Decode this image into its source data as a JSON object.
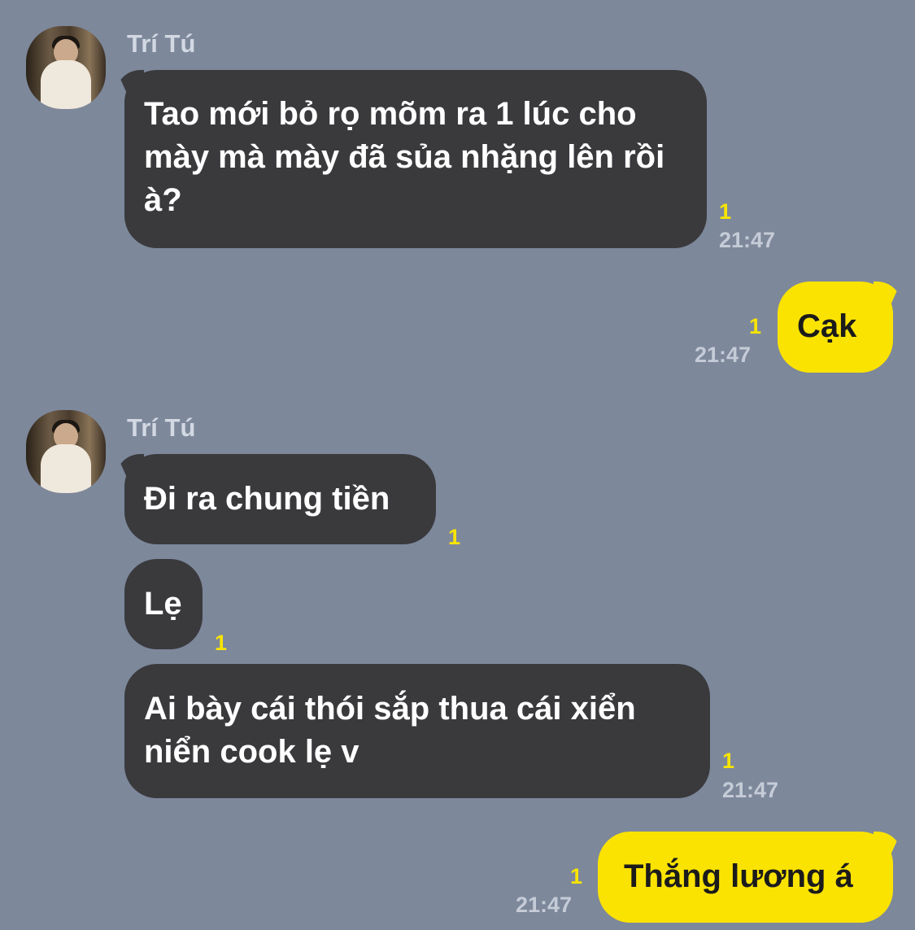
{
  "messages": [
    {
      "side": "in",
      "sender": "Trí Tú",
      "text": "Tao mới bỏ rọ mõm ra 1 lúc cho mày mà mày đã sủa nhặng lên rồi à?",
      "unread": "1",
      "time": "21:47"
    },
    {
      "side": "out",
      "text": "Cạk",
      "unread": "1",
      "time": "21:47"
    },
    {
      "side": "in",
      "sender": "Trí Tú",
      "text": "Đi ra chung tiền",
      "unread": "1"
    },
    {
      "side": "in",
      "text": "Lẹ",
      "unread": "1"
    },
    {
      "side": "in",
      "text": "Ai bày cái thói sắp thua cái xiển niển cook lẹ v",
      "unread": "1",
      "time": "21:47"
    },
    {
      "side": "out",
      "text": "Thắng lương á",
      "unread": "1",
      "time": "21:47"
    }
  ],
  "colors": {
    "background": "#7d889b",
    "incoming_bubble": "#3a3a3d",
    "outgoing_bubble": "#fbe301",
    "unread": "#f8e401"
  }
}
